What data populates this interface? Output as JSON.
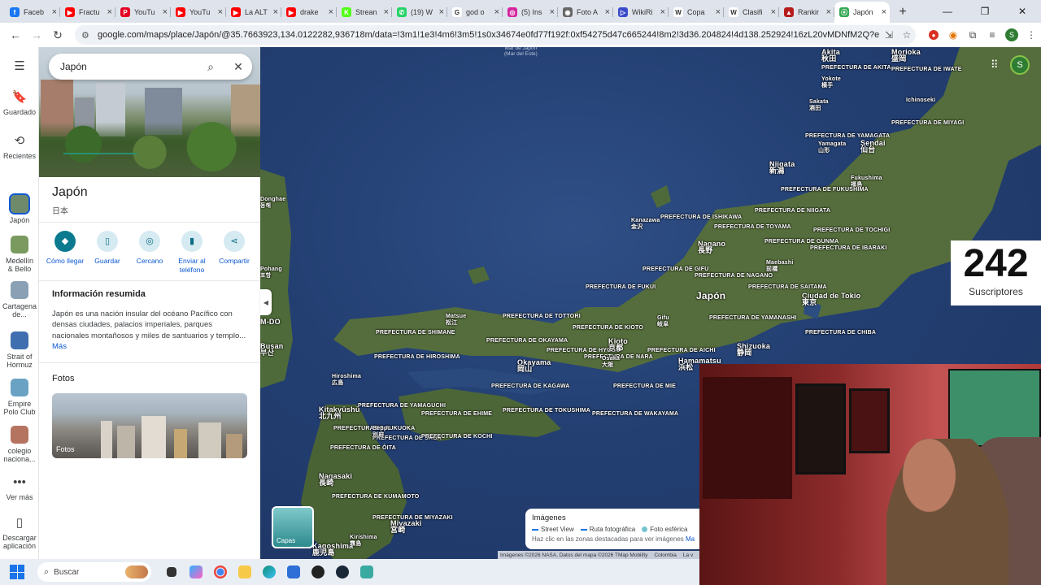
{
  "browser": {
    "tabs": [
      {
        "title": "Faceb",
        "favicon_color": "#1877f2",
        "glyph": "f"
      },
      {
        "title": "Fractu",
        "favicon_color": "#ff0000",
        "glyph": "▶"
      },
      {
        "title": "YouTu",
        "favicon_color": "#e60023",
        "glyph": "P"
      },
      {
        "title": "YouTu",
        "favicon_color": "#ff0000",
        "glyph": "▶"
      },
      {
        "title": "La ALT",
        "favicon_color": "#ff0000",
        "glyph": "▶"
      },
      {
        "title": "drake",
        "favicon_color": "#ff0000",
        "glyph": "▶"
      },
      {
        "title": "Strean",
        "favicon_color": "#53fc18",
        "glyph": "K"
      },
      {
        "title": "(19) W",
        "favicon_color": "#25d366",
        "glyph": "✆"
      },
      {
        "title": "god o",
        "favicon_color": "#ffffff",
        "glyph": "G"
      },
      {
        "title": "(5) Ins",
        "favicon_color": "#d6249f",
        "glyph": "◎"
      },
      {
        "title": "Foto A",
        "favicon_color": "#666666",
        "glyph": "◉"
      },
      {
        "title": "WikiRi",
        "favicon_color": "#3b4cca",
        "glyph": "▷"
      },
      {
        "title": "Copa",
        "favicon_color": "#ffffff",
        "glyph": "W"
      },
      {
        "title": "Clasifi",
        "favicon_color": "#ffffff",
        "glyph": "W"
      },
      {
        "title": "Rankir",
        "favicon_color": "#b71c1c",
        "glyph": "▲"
      },
      {
        "title": "Japón",
        "favicon_color": "#34a853",
        "glyph": "⦿",
        "active": true
      }
    ],
    "url": "google.com/maps/place/Japón/@35.7663923,134.0122282,936718m/data=!3m1!1e3!4m6!3m5!1s0x34674e0fd77f192f:0xf54275d47c665244!8m2!3d36.204824!4d138.252924!16zL20vMDNfM2Q?entry=ttu&g_ep=EgoyMDI2MDQxMi"
  },
  "rail": {
    "items": [
      {
        "label": "Guardado",
        "icon": "bookmark-icon",
        "glyph": "🔖"
      },
      {
        "label": "Recientes",
        "icon": "history-icon",
        "glyph": "⟲"
      },
      {
        "label": "Japón",
        "thumb_color": "#6f8a6a"
      },
      {
        "label": "Medellín & Bello",
        "thumb_color": "#7a9a60"
      },
      {
        "label": "Cartagena de...",
        "thumb_color": "#8aa0b4"
      },
      {
        "label": "Strait of Hormuz",
        "thumb_color": "#3f6fae"
      },
      {
        "label": "Empire Polo Club",
        "thumb_color": "#6aa2c4"
      },
      {
        "label": "colegio naciona...",
        "thumb_color": "#b57460"
      },
      {
        "label": "Ver más",
        "icon": "more-icon",
        "glyph": "•••"
      },
      {
        "label": "Descargar aplicación",
        "icon": "phone-icon",
        "glyph": "▯"
      }
    ]
  },
  "search": {
    "query": "Japón"
  },
  "place": {
    "title": "Japón",
    "native_name": "日本",
    "actions": [
      "Cómo llegar",
      "Guardar",
      "Cercano",
      "Enviar al teléfono",
      "Compartir"
    ],
    "summary_title": "Información resumida",
    "summary": "Japón es una nación insular del océano Pacífico con densas ciudades, palacios imperiales, parques nacionales montañosos y miles de santuarios y templo...",
    "more": "Más",
    "photos_title": "Fotos",
    "photos_label": "Fotos"
  },
  "map": {
    "sea_label": "Mar de Japón\n(Mar del Este)",
    "labels": [
      {
        "text": "Morioka\n盛岡",
        "cls": "city"
      },
      {
        "text": "Akita\n秋田",
        "cls": "city"
      },
      {
        "text": "PREFECTURA DE AKITA",
        "cls": ""
      },
      {
        "text": "Yokote\n横手",
        "cls": ""
      },
      {
        "text": "PREFECTURA DE IWATE",
        "cls": ""
      },
      {
        "text": "Ichinoseki",
        "cls": ""
      },
      {
        "text": "Sakata\n酒田",
        "cls": ""
      },
      {
        "text": "PREFECTURA DE MIYAGI",
        "cls": ""
      },
      {
        "text": "PREFECTURA DE YAMAGATA",
        "cls": ""
      },
      {
        "text": "Yamagata\n山形",
        "cls": ""
      },
      {
        "text": "Sendai\n仙台",
        "cls": "city"
      },
      {
        "text": "Niigata\n新潟",
        "cls": "city"
      },
      {
        "text": "Fukushima\n福島",
        "cls": ""
      },
      {
        "text": "PREFECTURA DE FUKUSHIMA",
        "cls": ""
      },
      {
        "text": "PREFECTURA DE NIIGATA",
        "cls": ""
      },
      {
        "text": "PREFECTURA DE ISHIKAWA",
        "cls": ""
      },
      {
        "text": "PREFECTURA DE TOCHIGI",
        "cls": ""
      },
      {
        "text": "Kanazawa\n金沢",
        "cls": ""
      },
      {
        "text": "PREFECTURA DE TOYAMA",
        "cls": ""
      },
      {
        "text": "PREFECTURA DE GUNMA",
        "cls": ""
      },
      {
        "text": "Nagano\n長野",
        "cls": "city"
      },
      {
        "text": "PREFECTURA DE IBARAKI",
        "cls": ""
      },
      {
        "text": "Maebashi\n前橋",
        "cls": ""
      },
      {
        "text": "PREFECTURA DE GIFU",
        "cls": ""
      },
      {
        "text": "PREFECTURA DE NAGANO",
        "cls": ""
      },
      {
        "text": "PREFECTURA DE SAITAMA",
        "cls": ""
      },
      {
        "text": "PREFECTURA DE FUKUI",
        "cls": ""
      },
      {
        "text": "Japón",
        "cls": "big"
      },
      {
        "text": "Ciudad de Tokio\n東京",
        "cls": "city"
      },
      {
        "text": "Matsue\n松江",
        "cls": ""
      },
      {
        "text": "PREFECTURA DE TOTTORI",
        "cls": ""
      },
      {
        "text": "PREFECTURA DE KIOTO",
        "cls": ""
      },
      {
        "text": "Gifu\n岐阜",
        "cls": ""
      },
      {
        "text": "PREFECTURA DE YAMANASHI",
        "cls": ""
      },
      {
        "text": "PREFECTURA DE CHIBA",
        "cls": ""
      },
      {
        "text": "PREFECTURA DE SHIMANE",
        "cls": ""
      },
      {
        "text": "PREFECTURA DE OKAYAMA",
        "cls": ""
      },
      {
        "text": "PREFECTURA DE HYOGO",
        "cls": ""
      },
      {
        "text": "PREFECTURA DE AICHI",
        "cls": ""
      },
      {
        "text": "PREFECTURA DE HIROSHIMA",
        "cls": ""
      },
      {
        "text": "Kioto\n京都",
        "cls": "city"
      },
      {
        "text": "Shizuoka\n静岡",
        "cls": "city"
      },
      {
        "text": "PREFECTURA DE NARA",
        "cls": ""
      },
      {
        "text": "Hamamatsu\n浜松",
        "cls": "city"
      },
      {
        "text": "Okayama\n岡山",
        "cls": "city"
      },
      {
        "text": "Osaka\n大阪",
        "cls": ""
      },
      {
        "text": "Hiroshima\n広島",
        "cls": ""
      },
      {
        "text": "PREFECTURA DE KAGAWA",
        "cls": ""
      },
      {
        "text": "PREFECTURA DE MIE",
        "cls": ""
      },
      {
        "text": "PREFECTURA DE YAMAGUCHI",
        "cls": ""
      },
      {
        "text": "PREFECTURA DE TOKUSHIMA",
        "cls": ""
      },
      {
        "text": "PREFECTURA DE WAKAYAMA",
        "cls": ""
      },
      {
        "text": "PREFECTURA DE EHIME",
        "cls": ""
      },
      {
        "text": "Kitakyūshū\n北九州",
        "cls": "city"
      },
      {
        "text": "PREFECTURA DE FUKUOKA",
        "cls": ""
      },
      {
        "text": "PREFECTURA DE SAGA",
        "cls": ""
      },
      {
        "text": "PREFECTURA DE KOCHI",
        "cls": ""
      },
      {
        "text": "PREFECTURA DE ŌITA",
        "cls": ""
      },
      {
        "text": "Beppu\n別府",
        "cls": ""
      },
      {
        "text": "Nagasaki\n長崎",
        "cls": "city"
      },
      {
        "text": "PREFECTURA DE KUMAMOTO",
        "cls": ""
      },
      {
        "text": "PREFECTURA DE MIYAZAKI",
        "cls": ""
      },
      {
        "text": "Miyazaki\n宮崎",
        "cls": "city"
      },
      {
        "text": "Kirishima\n霧島",
        "cls": ""
      },
      {
        "text": "Kagoshima\n鹿児島",
        "cls": "city"
      },
      {
        "text": "Busan\n부산",
        "cls": "city"
      },
      {
        "text": "M-DO",
        "cls": "city"
      },
      {
        "text": "Pohang\n포항",
        "cls": ""
      },
      {
        "text": "Donghae\n동해",
        "cls": ""
      }
    ],
    "subscribers": {
      "count": "242",
      "label": "Suscriptores"
    },
    "layers_label": "Capas",
    "legend": {
      "title": "Imágenes",
      "items": [
        "Street View",
        "Ruta fotográfica",
        "Foto esférica"
      ],
      "hint": "Haz clic en las zonas destacadas para ver imágenes",
      "hint_link": "Ma"
    },
    "attribution": [
      "Imágenes ©2026 NASA, Datos del mapa ©2026 TMap Mobility",
      "Colombia",
      "La v"
    ]
  },
  "taskbar": {
    "search_placeholder": "Buscar"
  }
}
